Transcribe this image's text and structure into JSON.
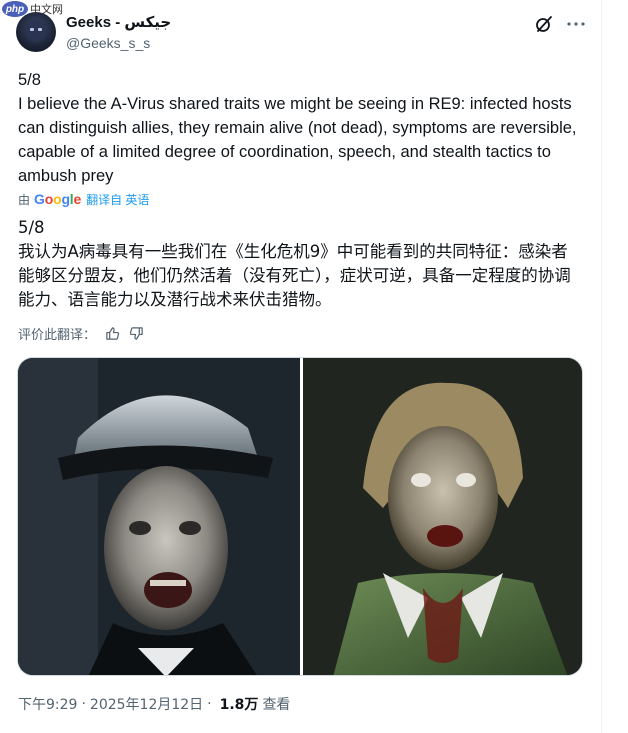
{
  "watermark": {
    "logo": "php",
    "text": "中文网"
  },
  "author": {
    "display_name": "Geeks - جيكس",
    "handle": "@Geeks_s_s"
  },
  "header_icons": [
    "grok-slash-icon",
    "more-options-icon"
  ],
  "post": {
    "en_lines": [
      "5/8",
      "I believe the A-Virus shared traits we might be seeing in RE9: infected hosts can distinguish allies, they remain alive (not dead), symptoms are reversible, capable of a limited degree of coordination, speech, and stealth tactics to ambush prey"
    ],
    "translation": {
      "by": "由",
      "google": "Google",
      "label": "翻译自 英语"
    },
    "zh_lines": [
      "5/8",
      "我认为A病毒具有一些我们在《生化危机9》中可能看到的共同特征：感染者能够区分盟友，他们仍然活着（没有死亡），症状可逆，具备一定程度的协调能力、语言能力以及潜行战术来伏击猎物。"
    ],
    "rate_label": "评价此翻译："
  },
  "media": [
    {
      "name": "zombie-officer-image"
    },
    {
      "name": "zombie-woman-image"
    }
  ],
  "meta": {
    "time": "下午9:29",
    "separator": "·",
    "date": "2025年12月12日",
    "views": "1.8万",
    "views_label": "查看"
  }
}
